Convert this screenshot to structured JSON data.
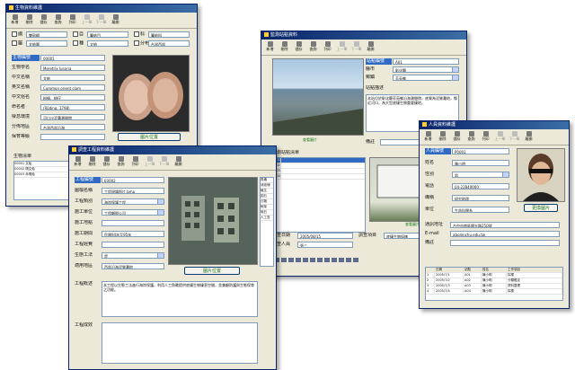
{
  "windows": {
    "shell": {
      "title": "生物資料維護",
      "toolbar": [
        {
          "label": "新增",
          "disabled": false
        },
        {
          "label": "刪除",
          "disabled": false
        },
        {
          "label": "儲存",
          "disabled": false
        },
        {
          "label": "查詢",
          "disabled": false
        },
        {
          "label": "列印",
          "disabled": false
        },
        {
          "label": "上一筆",
          "disabled": true
        },
        {
          "label": "下一筆",
          "disabled": true
        },
        {
          "label": "離開",
          "disabled": false
        }
      ],
      "chips": [
        {
          "label": "綱",
          "value": "雙殼綱"
        },
        {
          "label": "目",
          "value": "簾蛤目"
        },
        {
          "label": "科",
          "value": "簾蛤科"
        },
        {
          "label": "屬",
          "value": "文蛤屬"
        },
        {
          "label": "種",
          "value": "文蛤"
        },
        {
          "label": "分布",
          "value": "台灣西部"
        }
      ],
      "fields": [
        {
          "label": "生物編號",
          "value": "00001",
          "selected": true
        },
        {
          "label": "生物學名",
          "value": "Meretrix lusoria"
        },
        {
          "label": "中文名稱",
          "value": "文蛤"
        },
        {
          "label": "英文名稱",
          "value": "Common orient clam"
        },
        {
          "label": "中文俗名",
          "value": "粉蟯、蚶仔"
        },
        {
          "label": "命名者",
          "value": "(Röding, 1798)"
        },
        {
          "label": "棲息環境",
          "value": "河口沙泥灘潮間帶"
        },
        {
          "label": "分佈地區",
          "value": "台灣西部沿海"
        },
        {
          "label": "保育等級",
          "value": ""
        }
      ],
      "photo_button": "圖片位置",
      "list_title": "生物清單",
      "list_rows": [
        "00001  文蛤",
        "00002  環文蛤",
        "00003  赤嘴蛤"
      ]
    },
    "site": {
      "title": "監測站點資料",
      "toolbar": [
        {
          "label": "新增",
          "disabled": false
        },
        {
          "label": "刪除",
          "disabled": false
        },
        {
          "label": "儲存",
          "disabled": false
        },
        {
          "label": "查詢",
          "disabled": false
        },
        {
          "label": "列印",
          "disabled": false
        },
        {
          "label": "上一筆",
          "disabled": true
        },
        {
          "label": "下一筆",
          "disabled": true
        },
        {
          "label": "離開",
          "disabled": false
        }
      ],
      "fields": [
        {
          "label": "站點編號",
          "value": "A01",
          "selected": true
        },
        {
          "label": "縣市",
          "value": "彰化縣"
        },
        {
          "label": "鄉鎮",
          "value": "芳苑鄉"
        }
      ],
      "desc_label": "站點描述",
      "desc_text": "本站位於彰化縣芳苑鄉沿海潮間帶，底質為泥質灘地，鄰近河口，為大型底棲生物重要棲地。",
      "remark_label": "備註",
      "photo_caption": "查看圖片",
      "list_title": "監測站點清單",
      "list_rows": [
        "A01",
        "A02",
        "A03",
        "A04"
      ],
      "photo2_caption": "查看圖片",
      "bottom_fields": [
        {
          "label": "調查日期",
          "value": "2005/08/15"
        },
        {
          "label": "調查人員",
          "value": "張三"
        }
      ],
      "bottom2_fields": [
        {
          "label": "調查項目",
          "value": "底棲生物採樣"
        }
      ]
    },
    "engineer": {
      "title": "人員資料維護",
      "toolbar": [
        {
          "label": "新增",
          "disabled": false
        },
        {
          "label": "刪除",
          "disabled": false
        },
        {
          "label": "儲存",
          "disabled": false
        },
        {
          "label": "查詢",
          "disabled": false
        },
        {
          "label": "列印",
          "disabled": false
        },
        {
          "label": "上一筆",
          "disabled": true
        },
        {
          "label": "下一筆",
          "disabled": true
        },
        {
          "label": "離開",
          "disabled": false
        }
      ],
      "fields": [
        {
          "label": "人員編號",
          "value": "P0001",
          "selected": true
        },
        {
          "label": "姓名",
          "value": "陳小明"
        },
        {
          "label": "性別",
          "value": "男"
        },
        {
          "label": "電話",
          "value": "04-22840000"
        },
        {
          "label": "職稱",
          "value": "研究助理"
        },
        {
          "label": "單位",
          "value": "生命科學系"
        }
      ],
      "address_label": "通訊地址",
      "address_value": "台中市南區國光路250號",
      "email_label": "E-mail",
      "email_value": "abc@nchu.edu.tw",
      "note_label": "備註",
      "photo_button": "更換圖片",
      "grid_headers": [
        "",
        "日期",
        "站點",
        "姓名",
        "工作項目"
      ],
      "grid_rows": [
        [
          "1",
          "2005/7/1",
          "A01",
          "陳小明",
          "採樣"
        ],
        [
          "2",
          "2005/7/2",
          "A02",
          "陳小明",
          "分類鑑定"
        ],
        [
          "3",
          "2005/7/3",
          "A03",
          "陳小明",
          "資料整理"
        ],
        [
          "4",
          "2005/7/4",
          "A04",
          "陳小明",
          "採樣"
        ]
      ]
    },
    "project": {
      "title": "調查工程資料維護",
      "toolbar": [
        {
          "label": "新增",
          "disabled": false
        },
        {
          "label": "刪除",
          "disabled": false
        },
        {
          "label": "儲存",
          "disabled": false
        },
        {
          "label": "查詢",
          "disabled": false
        },
        {
          "label": "列印",
          "disabled": false
        },
        {
          "label": "上一筆",
          "disabled": true
        },
        {
          "label": "下一筆",
          "disabled": true
        },
        {
          "label": "離開",
          "disabled": false
        }
      ],
      "fields": [
        {
          "label": "工程編號",
          "value": "E0002",
          "selected": true
        },
        {
          "label": "圖檔名稱",
          "value": "工程現場照片.bmp"
        },
        {
          "label": "工程類別",
          "value": "海岸保護工程"
        },
        {
          "label": "施工單位",
          "value": "工程顧問公司"
        },
        {
          "label": "施工地點",
          "value": ""
        },
        {
          "label": "施工期間",
          "value": "民國94年至95年"
        },
        {
          "label": "工程經費",
          "value": ""
        },
        {
          "label": "生態工法",
          "value": "是"
        },
        {
          "label": "適用地區",
          "value": "西部沿海泥質灘地"
        }
      ],
      "photo_button": "圖片位置",
      "desc_label": "工程概述",
      "desc_text": "本工程以生態工法進行海岸保護，利用人工魚礁提供底棲生物棲息空間，並兼顧防護與生態保育之功能。",
      "effect_label": "工程成效",
      "side_list": [
        "魚礁",
        "消波塊",
        "植生",
        "拋石",
        "沉箱",
        "蚵架",
        "堆石",
        "人工島"
      ]
    }
  }
}
